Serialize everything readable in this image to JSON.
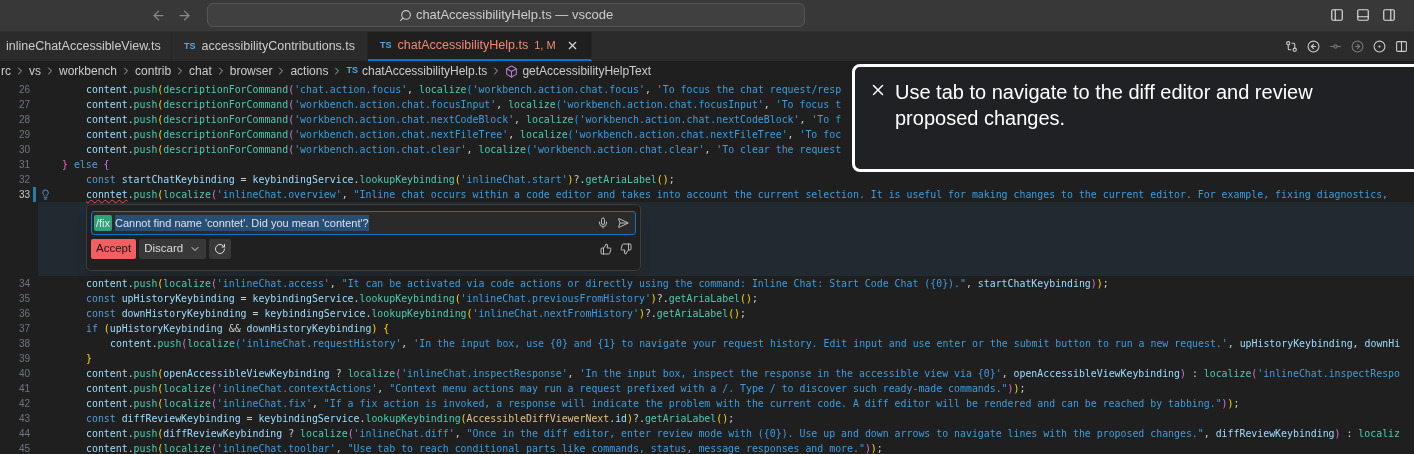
{
  "title_bar": {
    "title": "chatAccessibilityHelp.ts — vscode"
  },
  "tabs": [
    {
      "label": "inlineChatAccessibleView.ts",
      "selected": false,
      "error": false
    },
    {
      "file_type": "TS",
      "label": "accessibilityContributions.ts",
      "selected": false,
      "error": false
    },
    {
      "file_type": "TS",
      "label": "chatAccessibilityHelp.ts",
      "status": "1, M",
      "selected": true,
      "error": true
    }
  ],
  "breadcrumbs": [
    {
      "kind": "folder",
      "label": "rc"
    },
    {
      "kind": "folder",
      "label": "vs"
    },
    {
      "kind": "folder",
      "label": "workbench"
    },
    {
      "kind": "folder",
      "label": "contrib"
    },
    {
      "kind": "folder",
      "label": "chat"
    },
    {
      "kind": "folder",
      "label": "browser"
    },
    {
      "kind": "folder",
      "label": "actions"
    },
    {
      "kind": "file",
      "file_type": "TS",
      "label": "chatAccessibilityHelp.ts"
    },
    {
      "kind": "symbol",
      "label": "getAccessibilityHelpText"
    }
  ],
  "editor": {
    "items": [
      {
        "kind": "block",
        "children": [
          {
            "kind": "line",
            "number": "26",
            "current": false,
            "modified": false,
            "tokens": [
              {
                "kind": "v",
                "text": "content"
              },
              {
                "kind": "p",
                "text": "."
              },
              {
                "kind": "f",
                "text": "push"
              },
              {
                "kind": "y",
                "text": "("
              },
              {
                "kind": "f",
                "text": "descriptionForCommand"
              },
              {
                "kind": "m",
                "text": "("
              },
              {
                "kind": "s",
                "text": "'chat.action.focus'"
              },
              {
                "kind": "p",
                "text": ", "
              },
              {
                "kind": "f",
                "text": "localize"
              },
              {
                "kind": "b",
                "text": "("
              },
              {
                "kind": "s",
                "text": "'workbench.action.chat.focus'"
              },
              {
                "kind": "p",
                "text": ", "
              },
              {
                "kind": "s",
                "text": "'To focus the chat request/resp"
              }
            ]
          },
          {
            "kind": "line",
            "number": "27",
            "current": false,
            "modified": false,
            "tokens": [
              {
                "kind": "v",
                "text": "content"
              },
              {
                "kind": "p",
                "text": "."
              },
              {
                "kind": "f",
                "text": "push"
              },
              {
                "kind": "y",
                "text": "("
              },
              {
                "kind": "f",
                "text": "descriptionForCommand"
              },
              {
                "kind": "m",
                "text": "("
              },
              {
                "kind": "s",
                "text": "'workbench.action.chat.focusInput'"
              },
              {
                "kind": "p",
                "text": ", "
              },
              {
                "kind": "f",
                "text": "localize"
              },
              {
                "kind": "b",
                "text": "("
              },
              {
                "kind": "s",
                "text": "'workbench.action.chat.focusInput'"
              },
              {
                "kind": "p",
                "text": ", "
              },
              {
                "kind": "s",
                "text": "'To focus t"
              }
            ]
          },
          {
            "kind": "line",
            "number": "28",
            "current": false,
            "modified": false,
            "tokens": [
              {
                "kind": "v",
                "text": "content"
              },
              {
                "kind": "p",
                "text": "."
              },
              {
                "kind": "f",
                "text": "push"
              },
              {
                "kind": "y",
                "text": "("
              },
              {
                "kind": "f",
                "text": "descriptionForCommand"
              },
              {
                "kind": "m",
                "text": "("
              },
              {
                "kind": "s",
                "text": "'workbench.action.chat.nextCodeBlock'"
              },
              {
                "kind": "p",
                "text": ", "
              },
              {
                "kind": "f",
                "text": "localize"
              },
              {
                "kind": "b",
                "text": "("
              },
              {
                "kind": "s",
                "text": "'workbench.action.chat.nextCodeBlock'"
              },
              {
                "kind": "p",
                "text": ", "
              },
              {
                "kind": "s",
                "text": "'To f"
              }
            ]
          },
          {
            "kind": "line",
            "number": "29",
            "current": false,
            "modified": false,
            "tokens": [
              {
                "kind": "v",
                "text": "content"
              },
              {
                "kind": "p",
                "text": "."
              },
              {
                "kind": "f",
                "text": "push"
              },
              {
                "kind": "y",
                "text": "("
              },
              {
                "kind": "f",
                "text": "descriptionForCommand"
              },
              {
                "kind": "m",
                "text": "("
              },
              {
                "kind": "s",
                "text": "'workbench.action.chat.nextFileTree'"
              },
              {
                "kind": "p",
                "text": ", "
              },
              {
                "kind": "f",
                "text": "localize"
              },
              {
                "kind": "b",
                "text": "("
              },
              {
                "kind": "s",
                "text": "'workbench.action.chat.nextFileTree'"
              },
              {
                "kind": "p",
                "text": ", "
              },
              {
                "kind": "s",
                "text": "'To foc"
              }
            ]
          },
          {
            "kind": "line",
            "number": "30",
            "current": false,
            "modified": false,
            "tokens": [
              {
                "kind": "v",
                "text": "content"
              },
              {
                "kind": "p",
                "text": "."
              },
              {
                "kind": "f",
                "text": "push"
              },
              {
                "kind": "y",
                "text": "("
              },
              {
                "kind": "f",
                "text": "descriptionForCommand"
              },
              {
                "kind": "m",
                "text": "("
              },
              {
                "kind": "s",
                "text": "'workbench.action.chat.clear'"
              },
              {
                "kind": "p",
                "text": ", "
              },
              {
                "kind": "f",
                "text": "localize"
              },
              {
                "kind": "b",
                "text": "("
              },
              {
                "kind": "s",
                "text": "'workbench.action.chat.clear'"
              },
              {
                "kind": "p",
                "text": ", "
              },
              {
                "kind": "s",
                "text": "'To clear the request"
              }
            ]
          }
        ]
      },
      {
        "kind": "line",
        "number": "31",
        "current": false,
        "modified": false,
        "tokens": [
          {
            "kind": "m",
            "text": "} "
          },
          {
            "kind": "k",
            "text": "else"
          },
          {
            "kind": "m",
            "text": " {"
          }
        ],
        "children": [
          {
            "kind": "line",
            "number": "32",
            "current": false,
            "modified": false,
            "tokens": [
              {
                "kind": "k",
                "text": "const "
              },
              {
                "kind": "v",
                "text": "startChatKeybinding"
              },
              {
                "kind": "p",
                "text": " = "
              },
              {
                "kind": "v",
                "text": "keybindingService"
              },
              {
                "kind": "p",
                "text": "."
              },
              {
                "kind": "f",
                "text": "lookupKeybinding"
              },
              {
                "kind": "y",
                "text": "("
              },
              {
                "kind": "s",
                "text": "'inlineChat.start'"
              },
              {
                "kind": "y",
                "text": ")"
              },
              {
                "kind": "p",
                "text": "?."
              },
              {
                "kind": "f",
                "text": "getAriaLabel"
              },
              {
                "kind": "y",
                "text": "()"
              },
              {
                "kind": "p",
                "text": ";"
              }
            ]
          },
          {
            "kind": "line",
            "number": "33",
            "current": true,
            "modified": true,
            "tokens": [
              {
                "kind": "err",
                "text": "conntet"
              },
              {
                "kind": "p",
                "text": "."
              },
              {
                "kind": "f",
                "text": "push"
              },
              {
                "kind": "y",
                "text": "("
              },
              {
                "kind": "f",
                "text": "localize"
              },
              {
                "kind": "m",
                "text": "("
              },
              {
                "kind": "s",
                "text": "'inlineChat.overview'"
              },
              {
                "kind": "p",
                "text": ", "
              },
              {
                "kind": "s",
                "text": "\"Inline chat occurs within a code editor and takes into account the current selection. It is useful for making changes to the current editor. For example, fixing diagnostics,"
              }
            ]
          },
          {
            "kind": "inline_chat",
            "command": "/fix",
            "prompt": "Cannot find name 'conntet'. Did you mean 'content'?",
            "buttons": [
              {
                "kind": "accept",
                "label": "Accept"
              },
              {
                "kind": "discard",
                "label": "Discard"
              },
              {
                "kind": "rerun"
              }
            ]
          },
          {
            "kind": "line",
            "number": "34",
            "current": false,
            "modified": false,
            "tokens": [
              {
                "kind": "v",
                "text": "content"
              },
              {
                "kind": "p",
                "text": "."
              },
              {
                "kind": "f",
                "text": "push"
              },
              {
                "kind": "y",
                "text": "("
              },
              {
                "kind": "f",
                "text": "localize"
              },
              {
                "kind": "m",
                "text": "("
              },
              {
                "kind": "s",
                "text": "'inlineChat.access'"
              },
              {
                "kind": "p",
                "text": ", "
              },
              {
                "kind": "s",
                "text": "\"It can be activated via code actions or directly using the command: Inline Chat: Start Code Chat ({0}).\""
              },
              {
                "kind": "p",
                "text": ", "
              },
              {
                "kind": "v",
                "text": "startChatKeybinding"
              },
              {
                "kind": "m",
                "text": ")"
              },
              {
                "kind": "y",
                "text": ")"
              },
              {
                "kind": "p",
                "text": ";"
              }
            ]
          },
          {
            "kind": "line",
            "number": "35",
            "current": false,
            "modified": false,
            "tokens": [
              {
                "kind": "k",
                "text": "const "
              },
              {
                "kind": "v",
                "text": "upHistoryKeybinding"
              },
              {
                "kind": "p",
                "text": " = "
              },
              {
                "kind": "v",
                "text": "keybindingService"
              },
              {
                "kind": "p",
                "text": "."
              },
              {
                "kind": "f",
                "text": "lookupKeybinding"
              },
              {
                "kind": "y",
                "text": "("
              },
              {
                "kind": "s",
                "text": "'inlineChat.previousFromHistory'"
              },
              {
                "kind": "y",
                "text": ")"
              },
              {
                "kind": "p",
                "text": "?."
              },
              {
                "kind": "f",
                "text": "getAriaLabel"
              },
              {
                "kind": "y",
                "text": "()"
              },
              {
                "kind": "p",
                "text": ";"
              }
            ]
          },
          {
            "kind": "line",
            "number": "36",
            "current": false,
            "modified": false,
            "tokens": [
              {
                "kind": "k",
                "text": "const "
              },
              {
                "kind": "v",
                "text": "downHistoryKeybinding"
              },
              {
                "kind": "p",
                "text": " = "
              },
              {
                "kind": "v",
                "text": "keybindingService"
              },
              {
                "kind": "p",
                "text": "."
              },
              {
                "kind": "f",
                "text": "lookupKeybinding"
              },
              {
                "kind": "y",
                "text": "("
              },
              {
                "kind": "s",
                "text": "'inlineChat.nextFromHistory'"
              },
              {
                "kind": "y",
                "text": ")"
              },
              {
                "kind": "p",
                "text": "?."
              },
              {
                "kind": "f",
                "text": "getAriaLabel"
              },
              {
                "kind": "y",
                "text": "()"
              },
              {
                "kind": "p",
                "text": ";"
              }
            ]
          },
          {
            "kind": "line",
            "number": "37",
            "current": false,
            "modified": false,
            "tokens": [
              {
                "kind": "k",
                "text": "if "
              },
              {
                "kind": "y",
                "text": "("
              },
              {
                "kind": "v",
                "text": "upHistoryKeybinding"
              },
              {
                "kind": "p",
                "text": " && "
              },
              {
                "kind": "v",
                "text": "downHistoryKeybinding"
              },
              {
                "kind": "y",
                "text": ") {"
              }
            ],
            "children": [
              {
                "kind": "line",
                "number": "38",
                "current": false,
                "modified": false,
                "tokens": [
                  {
                    "kind": "v",
                    "text": "content"
                  },
                  {
                    "kind": "p",
                    "text": "."
                  },
                  {
                    "kind": "f",
                    "text": "push"
                  },
                  {
                    "kind": "m",
                    "text": "("
                  },
                  {
                    "kind": "f",
                    "text": "localize"
                  },
                  {
                    "kind": "b",
                    "text": "("
                  },
                  {
                    "kind": "s",
                    "text": "'inlineChat.requestHistory'"
                  },
                  {
                    "kind": "p",
                    "text": ", "
                  },
                  {
                    "kind": "s",
                    "text": "'In the input box, use {0} and {1} to navigate your request history. Edit input and use enter or the submit button to run a new request.'"
                  },
                  {
                    "kind": "p",
                    "text": ", "
                  },
                  {
                    "kind": "v",
                    "text": "upHistoryKeybinding"
                  },
                  {
                    "kind": "p",
                    "text": ", "
                  },
                  {
                    "kind": "v",
                    "text": "downHi"
                  }
                ]
              }
            ]
          },
          {
            "kind": "line",
            "number": "39",
            "current": false,
            "modified": false,
            "tokens": [
              {
                "kind": "y",
                "text": "}"
              }
            ]
          },
          {
            "kind": "line",
            "number": "40",
            "current": false,
            "modified": false,
            "tokens": [
              {
                "kind": "v",
                "text": "content"
              },
              {
                "kind": "p",
                "text": "."
              },
              {
                "kind": "f",
                "text": "push"
              },
              {
                "kind": "y",
                "text": "("
              },
              {
                "kind": "v",
                "text": "openAccessibleViewKeybinding"
              },
              {
                "kind": "p",
                "text": " ? "
              },
              {
                "kind": "f",
                "text": "localize"
              },
              {
                "kind": "m",
                "text": "("
              },
              {
                "kind": "s",
                "text": "'inlineChat.inspectResponse'"
              },
              {
                "kind": "p",
                "text": ", "
              },
              {
                "kind": "s",
                "text": "'In the input box, inspect the response in the accessible view via {0}'"
              },
              {
                "kind": "p",
                "text": ", "
              },
              {
                "kind": "v",
                "text": "openAccessibleViewKeybinding"
              },
              {
                "kind": "m",
                "text": ")"
              },
              {
                "kind": "p",
                "text": " : "
              },
              {
                "kind": "f",
                "text": "localize"
              },
              {
                "kind": "m",
                "text": "("
              },
              {
                "kind": "s",
                "text": "'inlineChat.inspectRespo"
              }
            ]
          },
          {
            "kind": "line",
            "number": "41",
            "current": false,
            "modified": false,
            "tokens": [
              {
                "kind": "v",
                "text": "content"
              },
              {
                "kind": "p",
                "text": "."
              },
              {
                "kind": "f",
                "text": "push"
              },
              {
                "kind": "y",
                "text": "("
              },
              {
                "kind": "f",
                "text": "localize"
              },
              {
                "kind": "m",
                "text": "("
              },
              {
                "kind": "s",
                "text": "'inlineChat.contextActions'"
              },
              {
                "kind": "p",
                "text": ", "
              },
              {
                "kind": "s",
                "text": "\"Context menu actions may run a request prefixed with a /. Type / to discover such ready-made commands.\""
              },
              {
                "kind": "m",
                "text": ")"
              },
              {
                "kind": "y",
                "text": ")"
              },
              {
                "kind": "p",
                "text": ";"
              }
            ]
          },
          {
            "kind": "line",
            "number": "42",
            "current": false,
            "modified": false,
            "tokens": [
              {
                "kind": "v",
                "text": "content"
              },
              {
                "kind": "p",
                "text": "."
              },
              {
                "kind": "f",
                "text": "push"
              },
              {
                "kind": "y",
                "text": "("
              },
              {
                "kind": "f",
                "text": "localize"
              },
              {
                "kind": "m",
                "text": "("
              },
              {
                "kind": "s",
                "text": "'inlineChat.fix'"
              },
              {
                "kind": "p",
                "text": ", "
              },
              {
                "kind": "s",
                "text": "\"If a fix action is invoked, a response will indicate the problem with the current code. A diff editor will be rendered and can be reached by tabbing.\""
              },
              {
                "kind": "m",
                "text": ")"
              },
              {
                "kind": "y",
                "text": ")"
              },
              {
                "kind": "p",
                "text": ";"
              }
            ]
          },
          {
            "kind": "line",
            "number": "43",
            "current": false,
            "modified": false,
            "tokens": [
              {
                "kind": "k",
                "text": "const "
              },
              {
                "kind": "v",
                "text": "diffReviewKeybinding"
              },
              {
                "kind": "p",
                "text": " = "
              },
              {
                "kind": "v",
                "text": "keybindingService"
              },
              {
                "kind": "p",
                "text": "."
              },
              {
                "kind": "f",
                "text": "lookupKeybinding"
              },
              {
                "kind": "y",
                "text": "("
              },
              {
                "kind": "c",
                "text": "AccessibleDiffViewerNext"
              },
              {
                "kind": "p",
                "text": "."
              },
              {
                "kind": "v",
                "text": "id"
              },
              {
                "kind": "y",
                "text": ")"
              },
              {
                "kind": "p",
                "text": "?."
              },
              {
                "kind": "f",
                "text": "getAriaLabel"
              },
              {
                "kind": "y",
                "text": "()"
              },
              {
                "kind": "p",
                "text": ";"
              }
            ]
          },
          {
            "kind": "line",
            "number": "44",
            "current": false,
            "modified": false,
            "tokens": [
              {
                "kind": "v",
                "text": "content"
              },
              {
                "kind": "p",
                "text": "."
              },
              {
                "kind": "f",
                "text": "push"
              },
              {
                "kind": "y",
                "text": "("
              },
              {
                "kind": "v",
                "text": "diffReviewKeybinding"
              },
              {
                "kind": "p",
                "text": " ? "
              },
              {
                "kind": "f",
                "text": "localize"
              },
              {
                "kind": "m",
                "text": "("
              },
              {
                "kind": "s",
                "text": "'inlineChat.diff'"
              },
              {
                "kind": "p",
                "text": ", "
              },
              {
                "kind": "s",
                "text": "\"Once in the diff editor, enter review mode with ({0}). Use up and down arrows to navigate lines with the proposed changes.\""
              },
              {
                "kind": "p",
                "text": ", "
              },
              {
                "kind": "v",
                "text": "diffReviewKeybinding"
              },
              {
                "kind": "m",
                "text": ")"
              },
              {
                "kind": "p",
                "text": " : "
              },
              {
                "kind": "f",
                "text": "localiz"
              }
            ]
          },
          {
            "kind": "line",
            "number": "45",
            "current": false,
            "modified": false,
            "tokens": [
              {
                "kind": "v",
                "text": "content"
              },
              {
                "kind": "p",
                "text": "."
              },
              {
                "kind": "f",
                "text": "push"
              },
              {
                "kind": "y",
                "text": "("
              },
              {
                "kind": "f",
                "text": "localize"
              },
              {
                "kind": "m",
                "text": "("
              },
              {
                "kind": "s",
                "text": "'inlineChat.toolbar'"
              },
              {
                "kind": "p",
                "text": ", "
              },
              {
                "kind": "s",
                "text": "\"Use tab to reach conditional parts like commands, status, message responses and more.\""
              },
              {
                "kind": "m",
                "text": ")"
              },
              {
                "kind": "y",
                "text": ")"
              },
              {
                "kind": "p",
                "text": ";"
              }
            ]
          }
        ]
      }
    ]
  },
  "notification": {
    "message": "Use tab to navigate to the diff editor and review proposed changes."
  }
}
